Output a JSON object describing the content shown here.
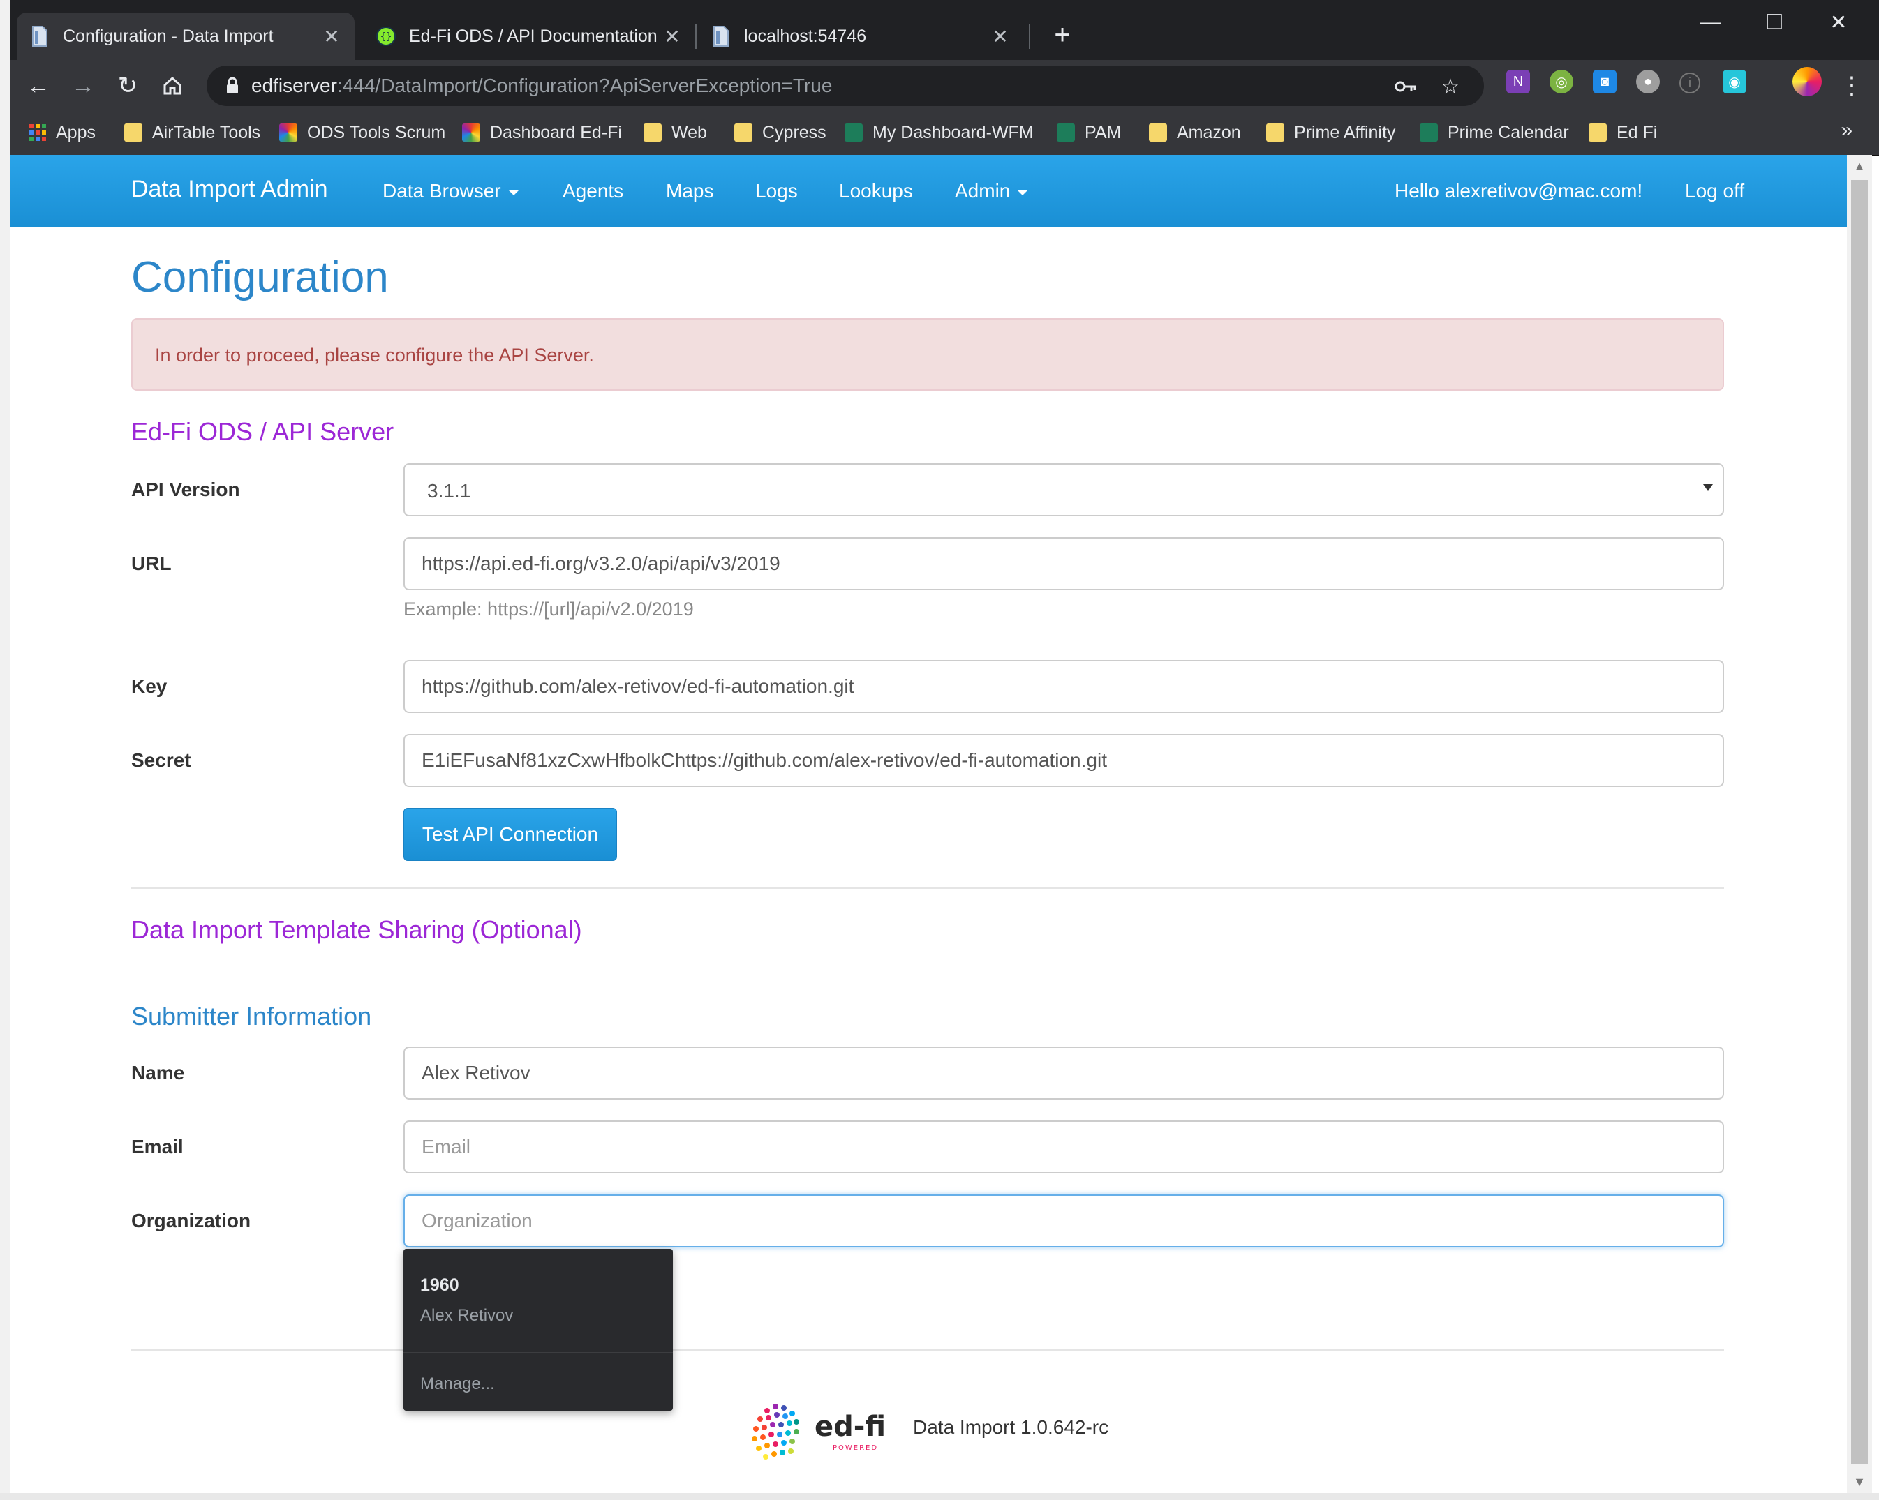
{
  "browser": {
    "tabs": [
      {
        "title": "Configuration - Data Import",
        "active": true
      },
      {
        "title": "Ed-Fi ODS / API Documentation",
        "active": false
      },
      {
        "title": "localhost:54746",
        "active": false
      }
    ],
    "address": {
      "host": "edfiserver",
      "path": ":444/DataImport/Configuration?ApiServerException=True"
    },
    "bookmarks": [
      {
        "label": "Apps",
        "icon": "apps-grid-icon"
      },
      {
        "label": "AirTable Tools",
        "icon": "folder-icon"
      },
      {
        "label": "ODS Tools Scrum",
        "icon": "starburst-icon"
      },
      {
        "label": "Dashboard Ed-Fi",
        "icon": "starburst-icon"
      },
      {
        "label": "Web",
        "icon": "folder-icon"
      },
      {
        "label": "Cypress",
        "icon": "folder-icon"
      },
      {
        "label": "My Dashboard-WFM",
        "icon": "wfm-icon"
      },
      {
        "label": "PAM",
        "icon": "wfm-icon"
      },
      {
        "label": "Amazon",
        "icon": "folder-icon"
      },
      {
        "label": "Prime Affinity",
        "icon": "folder-icon"
      },
      {
        "label": "Prime Calendar",
        "icon": "wfm-icon"
      },
      {
        "label": "Ed Fi",
        "icon": "folder-icon"
      }
    ],
    "bookmarks_more": "»"
  },
  "navbar": {
    "brand": "Data Import Admin",
    "links": [
      "Data Browser",
      "Agents",
      "Maps",
      "Logs",
      "Lookups",
      "Admin"
    ],
    "greeting": "Hello alexretivov@mac.com!",
    "logoff": "Log off"
  },
  "page": {
    "title": "Configuration",
    "alert": "In order to proceed, please configure the API Server.",
    "api_section": {
      "heading": "Ed-Fi ODS / API Server",
      "api_version_label": "API Version",
      "api_version_value": "3.1.1",
      "url_label": "URL",
      "url_value": "https://api.ed-fi.org/v3.2.0/api/api/v3/2019",
      "url_help": "Example: https://[url]/api/v2.0/2019",
      "key_label": "Key",
      "key_value": "https://github.com/alex-retivov/ed-fi-automation.git",
      "secret_label": "Secret",
      "secret_value": "E1iEFusaNf81xzCxwHfbolkChttps://github.com/alex-retivov/ed-fi-automation.git",
      "test_button": "Test API Connection"
    },
    "sharing_heading": "Data Import Template Sharing (Optional)",
    "submitter": {
      "heading": "Submitter Information",
      "name_label": "Name",
      "name_value": "Alex Retivov",
      "email_label": "Email",
      "email_placeholder": "Email",
      "org_label": "Organization",
      "org_placeholder": "Organization"
    },
    "autofill": {
      "title": "1960",
      "subtitle": "Alex Retivov",
      "manage": "Manage..."
    },
    "footer": {
      "logo_text": "ed-fi",
      "logo_sub": "POWERED",
      "version": "Data Import 1.0.642-rc"
    }
  },
  "colors": {
    "navbar": "#1f97dd",
    "heading_blue": "#2c86c9",
    "heading_purple": "#9c27d6",
    "alert_bg": "#f2dede",
    "alert_text": "#a94442"
  }
}
